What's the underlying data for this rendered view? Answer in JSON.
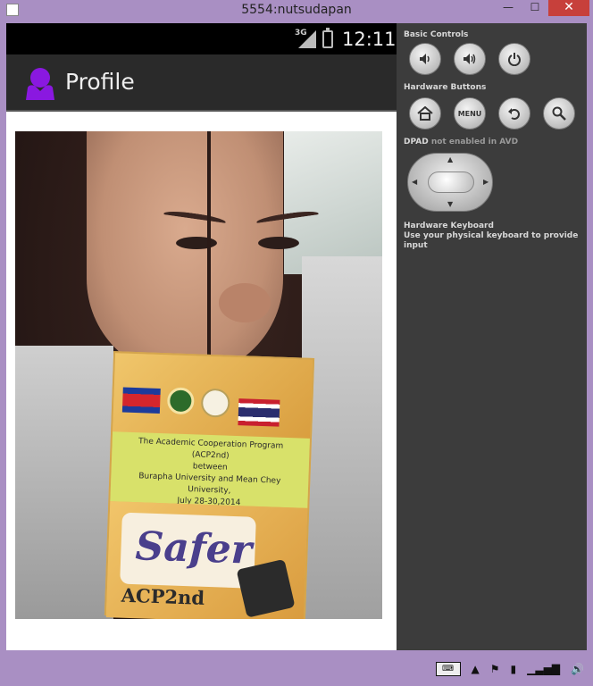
{
  "window": {
    "title": "5554:nutsudapan",
    "minimize_label": "—",
    "maximize_label": "☐",
    "close_label": "✕"
  },
  "statusbar": {
    "network_label": "3G",
    "time": "12:11"
  },
  "actionbar": {
    "title": "Profile",
    "icon": "person-icon"
  },
  "photo": {
    "badge": {
      "text_line1": "The Academic Cooperation Program (ACP2nd)",
      "text_line2": "between",
      "text_line3": "Burapha University and Mean Chey University,",
      "text_line4": "July 28-30,2014",
      "name": "Safer",
      "code": "ACP2nd"
    }
  },
  "controls": {
    "basic_controls_label": "Basic Controls",
    "basic_buttons": [
      {
        "name": "volume-down-icon",
        "glyph": "🔈"
      },
      {
        "name": "volume-up-icon",
        "glyph": "🔊"
      },
      {
        "name": "power-icon",
        "glyph": "⏻"
      }
    ],
    "hardware_buttons_label": "Hardware Buttons",
    "hardware_buttons": [
      {
        "name": "home-icon",
        "glyph": "⌂"
      },
      {
        "name": "menu-button",
        "glyph": "MENU"
      },
      {
        "name": "back-icon",
        "glyph": "↶"
      },
      {
        "name": "search-icon",
        "glyph": "⚲"
      }
    ],
    "dpad_label_bold": "DPAD",
    "dpad_label_rest": " not enabled in AVD",
    "keyboard_title": "Hardware Keyboard",
    "keyboard_desc": "Use your physical keyboard to provide input"
  },
  "taskbar": {
    "tray_icons": [
      "keyboard-icon",
      "chevron-up-icon",
      "flag-icon",
      "battery-icon",
      "signal-icon",
      "speaker-icon"
    ]
  }
}
